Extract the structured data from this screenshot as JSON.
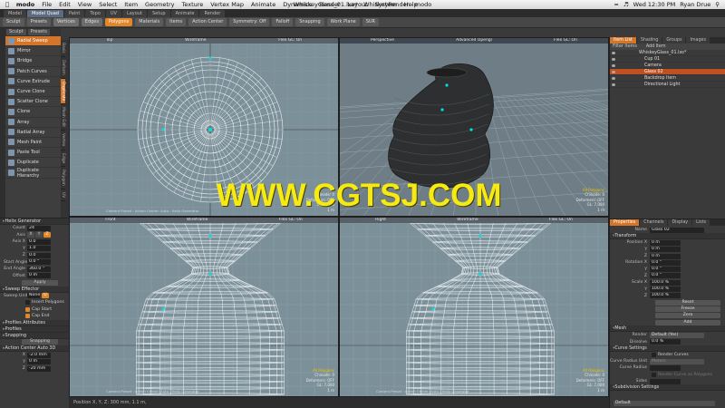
{
  "os_menu": {
    "app": "modo",
    "items": [
      "File",
      "Edit",
      "View",
      "Select",
      "Item",
      "Geometry",
      "Texture",
      "Vertex Map",
      "Animate",
      "Dynamics",
      "Render",
      "Layout",
      "System",
      "Help"
    ],
    "window_title": "WhiskeyGlass_01.lxo* : WhiskeyRender - modo",
    "clock": "Wed 12:30 PM",
    "user": "Ryan Drue",
    "accent": "#d4762a"
  },
  "layout_tabs": [
    "Model",
    "Model Quad",
    "Paint",
    "Topo",
    "UV",
    "Layout",
    "Setup",
    "Animate",
    "Render"
  ],
  "layout_active": 1,
  "toolbar": [
    "Sculpt",
    "Presets",
    "Vertices",
    "Edges",
    "Polygons",
    "Materials",
    "Items",
    "Action Center",
    "Symmetry: Off",
    "Falloff",
    "Snapping",
    "Work Plane",
    "SUR"
  ],
  "toolbar_active": 4,
  "left_tabs": [
    "Basic",
    "Deform",
    "Duplicate",
    "Mesh Edit",
    "Vertex",
    "Edge",
    "Polygon",
    "UV"
  ],
  "left_tab_active": 2,
  "toolpanel_header": [
    "Sculpt",
    "Presets"
  ],
  "tools": [
    "Radial Sweep",
    "Mirror",
    "Bridge",
    "Patch Curves",
    "Curve Extrude",
    "Curve Clone",
    "Scatter Clone",
    "Clone",
    "Array",
    "Radial Array",
    "Mesh Paint",
    "Paste Tool",
    "Duplicate",
    "Duplicate Hierarchy"
  ],
  "tool_active": 0,
  "helix": {
    "section": "Helix Generator",
    "count_label": "Count",
    "count": "24",
    "axis_label": "Axis",
    "axes": [
      "X",
      "Y",
      "Z"
    ],
    "axis_active": 2,
    "axis_x_label": "Axis X",
    "axis_x": "0.0",
    "axis_y_label": "Y",
    "axis_y": "1.0",
    "axis_z_label": "Z",
    "axis_z": "0.0",
    "start_label": "Start Angle",
    "start": "0.0 °",
    "end_label": "End Angle",
    "end": "360.0 °",
    "offset_label": "Offset",
    "offset": "0 m",
    "apply": "Apply"
  },
  "sweep": {
    "section": "Sweep Effector",
    "units_label": "Sweep Units",
    "units_value": "None",
    "units_axis": "U",
    "insert": "Insert Polygons",
    "cap_start": "Cap Start",
    "cap_end": "Cap End"
  },
  "prop_sections": [
    "Profiles Attributes",
    "Profiles",
    "Snapping"
  ],
  "snapping_value": "Snapping",
  "action_center": {
    "section": "Action Center Auto 3D",
    "x": "-2.0 mm",
    "y": "0 m",
    "z": "-20 mm"
  },
  "viewports": [
    {
      "labels": [
        "Top",
        "Wireframe",
        "Flex GL: On"
      ],
      "chips": "",
      "info": "Chinode: 0\nDeformers: OFF\nGL: 7,020\n1 m",
      "hl": "",
      "foot": ""
    },
    {
      "labels": [
        "Perspective",
        "Advanced Opengl",
        "Flex GL: On"
      ],
      "chips": "",
      "info": "Chinode: 0\nDeformers: OFF\nGL: 7,000\n1 m",
      "hl": "All Polygons",
      "foot": ""
    },
    {
      "labels": [
        "Front",
        "Wireframe",
        "Flex GL: On"
      ],
      "chips": "",
      "info": "Chinode: 0\nDeformers: OFF\nGL: 7,000\n1 m",
      "hl": "All Polygons",
      "foot": "Content Preset : Action Center: Auto : Helix Generator"
    },
    {
      "labels": [
        "Right",
        "Wireframe",
        "Flex GL: On"
      ],
      "chips": "",
      "info": "Chinode: 0\nDeformers: OFF\nGL: 7,000\n1 m",
      "hl": "All Polygons",
      "foot": "Content Preset : Action Center: Auto : Helix Generator"
    }
  ],
  "vp0_foot": "Content Preset : Action Center: Auto : Helix Generator",
  "watermark": "WWW.CGTSJ.COM",
  "status": "Position X, Y, Z:  300 mm, 1.1 m,",
  "items_panel": {
    "tabs": [
      "Item List",
      "Shading",
      "Groups",
      "Images"
    ],
    "filter": "Filter Items",
    "add": "Add Item",
    "tree": [
      "WhiskeyGlass_01.lxo*",
      "Cup 01",
      "Camera",
      "Glass 02",
      "Backdrop Item",
      "Directional Light"
    ],
    "selected": 3
  },
  "properties": {
    "tabs": [
      "Properties",
      "Channels",
      "Display",
      "Lists"
    ],
    "name_label": "Name",
    "name": "Glass 02",
    "transform": "Transform",
    "position_label": "Position X",
    "pos": [
      "0 m",
      "0 m",
      "0 m"
    ],
    "rotation_label": "Rotation X",
    "rot": [
      "0.0 °",
      "0.0 °",
      "0.0 °"
    ],
    "scale_label": "Scale X",
    "scale": [
      "100.0 %",
      "100.0 %",
      "100.0 %"
    ],
    "y_label": "Y",
    "z_label": "Z",
    "buttons": [
      "Reset",
      "Freeze",
      "Zero",
      "Add"
    ],
    "mesh": "Mesh",
    "render_label": "Render",
    "render": "Default (Yes)",
    "dissolve_label": "Dissolve",
    "dissolve": "0.0 %",
    "curve": "Curve Settings",
    "render_curves": "Render Curves",
    "radius_unit_label": "Curve Radius Unit",
    "radius_unit": "Meters",
    "radius_label": "Curve Radius",
    "render_poly": "Render Curve as Polygons",
    "sides_label": "Sides",
    "subdiv": "Subdivision Settings",
    "bottom": "Default"
  }
}
